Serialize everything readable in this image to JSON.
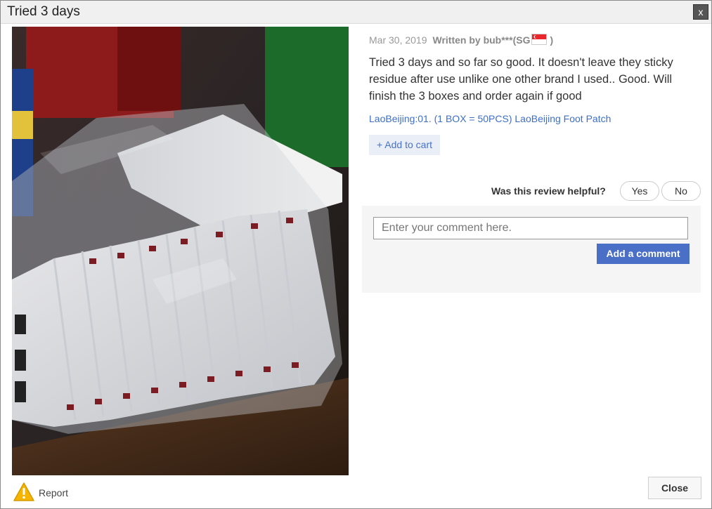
{
  "dialog": {
    "title": "Tried 3 days",
    "close_icon": "close-icon",
    "close_glyph": "x"
  },
  "review": {
    "date": "Mar 30, 2019",
    "author": "Written by bub***(SG",
    "author_suffix": ")",
    "country_flag_icon": "singapore-flag-icon",
    "text": "Tried 3 days and so far so good. It doesn't leave they sticky residue after use unlike one other brand I used.. Good. Will finish the 3 boxes and order again if good",
    "product": "LaoBeijing:01. (1 BOX = 50PCS) LaoBeijing Foot Patch",
    "add_to_cart": "+ Add to cart",
    "photo": "review-photo"
  },
  "helpful": {
    "question": "Was this review helpful?",
    "yes": "Yes",
    "no": "No"
  },
  "comment": {
    "placeholder": "Enter your comment here.",
    "submit": "Add a comment"
  },
  "footer": {
    "report_icon": "warning-icon",
    "report": "Report",
    "close": "Close"
  },
  "colors": {
    "link": "#3f6fc4",
    "primary_button": "#4a6fc6",
    "warning": "#f5b400"
  }
}
